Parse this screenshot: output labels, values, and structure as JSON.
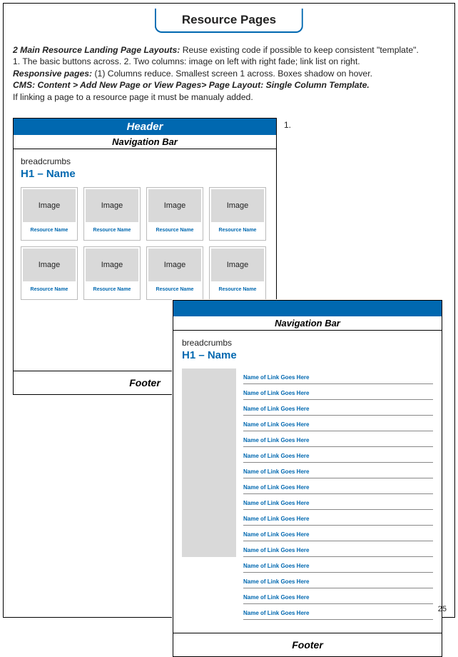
{
  "title": "Resource Pages",
  "intro": {
    "l1b": "2 Main Resource Landing Page Layouts:",
    "l1": " Reuse existing code if possible to keep consistent \"template\".",
    "l2": "1. The basic buttons across. 2. Two columns: image on left with right fade; link list on right.",
    "l3b": "Responsive pages:",
    "l3": " (1) Columns reduce. Smallest screen 1 across. Boxes shadow on hover.",
    "l4b": "CMS: Content > Add New Page or View Pages> Page Layout: Single Column Template.",
    "l5": "If linking a page to a resource page it must be manualy added."
  },
  "marker1": "1.",
  "wf": {
    "header": "Header",
    "navbar": "Navigation Bar",
    "breadcrumbs": "breadcrumbs",
    "h1": "H1 – Name",
    "footer": "Footer",
    "image": "Image",
    "resource": "Resource Name",
    "linktext": "Name of Link Goes Here"
  },
  "cards": [
    0,
    1,
    2,
    3,
    4,
    5,
    6,
    7
  ],
  "links": [
    0,
    1,
    2,
    3,
    4,
    5,
    6,
    7,
    8,
    9,
    10,
    11,
    12,
    13,
    14,
    15
  ],
  "pagenum": "25"
}
